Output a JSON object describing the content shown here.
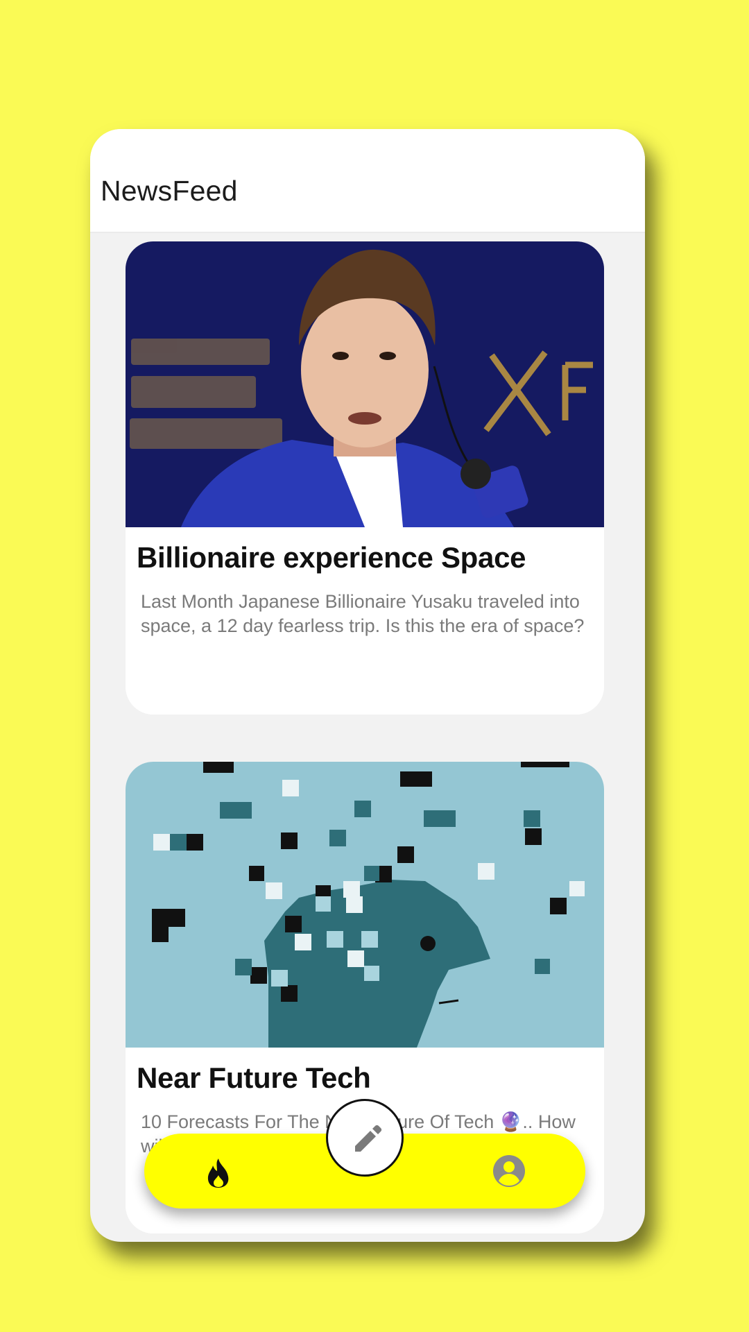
{
  "app": {
    "title": "NewsFeed"
  },
  "feed": {
    "articles": [
      {
        "title": "Billionaire experience Space",
        "description": "Last Month Japanese Billionaire Yusaku traveled into space, a 12 day fearless trip. Is this the era of space?",
        "image_icon": "portrait-photo"
      },
      {
        "title": "Near Future Tech",
        "description": "10 Forecasts For The Near Future Of Tech 🔮.. How will",
        "image_icon": "pixelated-head-illustration"
      }
    ]
  },
  "bottom_nav": {
    "left_icon": "fire-icon",
    "center_icon": "pencil-icon",
    "right_icon": "profile-icon"
  },
  "colors": {
    "page_background": "#fafa55",
    "nav_background": "#ffff00",
    "card_background": "#ffffff",
    "feed_background": "#f2f2f2"
  }
}
